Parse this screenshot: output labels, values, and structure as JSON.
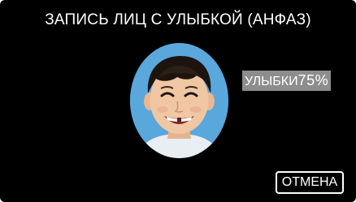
{
  "screen": {
    "title": "ЗАПИСЬ ЛИЦ С УЛЫБКОЙ (АНФАЗ)",
    "background_color": "#000000"
  },
  "face_preview": {
    "frame_color": "#4a9bd4",
    "subject": "smiling-child-face-photo"
  },
  "smile_indicator": {
    "label": "УЛЫБКИ",
    "value": "75%",
    "background_color": "#8d8d8d"
  },
  "actions": {
    "cancel_label": "ОТМЕНА"
  }
}
